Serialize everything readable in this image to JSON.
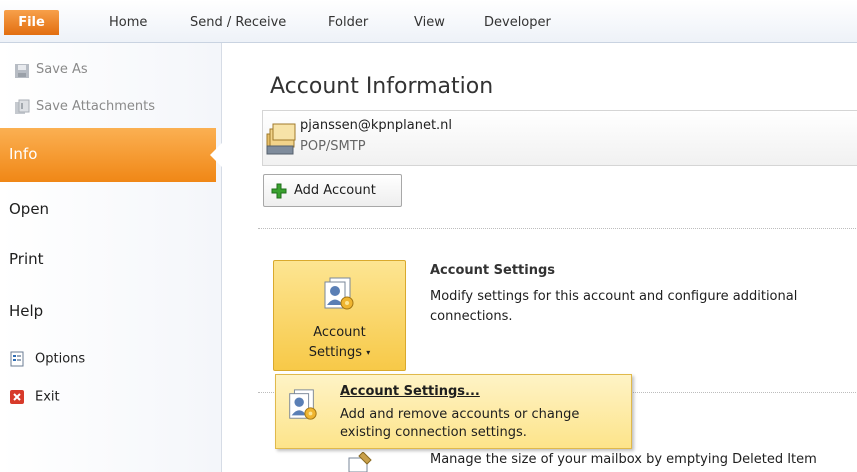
{
  "ribbon": {
    "tabs": [
      "File",
      "Home",
      "Send / Receive",
      "Folder",
      "View",
      "Developer"
    ]
  },
  "nav": {
    "save_as": "Save As",
    "save_attachments": "Save Attachments",
    "info": "Info",
    "open": "Open",
    "print": "Print",
    "help": "Help",
    "options": "Options",
    "exit": "Exit"
  },
  "main": {
    "title": "Account Information",
    "account_email": "pjanssen@kpnplanet.nl",
    "account_type": "POP/SMTP",
    "add_account": "Add Account",
    "account_settings_button_line1": "Account",
    "account_settings_button_line2": "Settings",
    "account_settings_heading": "Account Settings",
    "account_settings_desc": "Modify settings for this account and configure additional connections.",
    "cleanup_desc": "Manage the size of your mailbox by emptying Deleted Item"
  },
  "dropdown": {
    "title": "Account Settings...",
    "desc": "Add and remove accounts or change existing connection settings."
  },
  "colors": {
    "file_tab": "#e26e10",
    "info_selected": "#f08716",
    "button_hover": "#f7c948",
    "dropdown_bg": "#fde48a"
  }
}
